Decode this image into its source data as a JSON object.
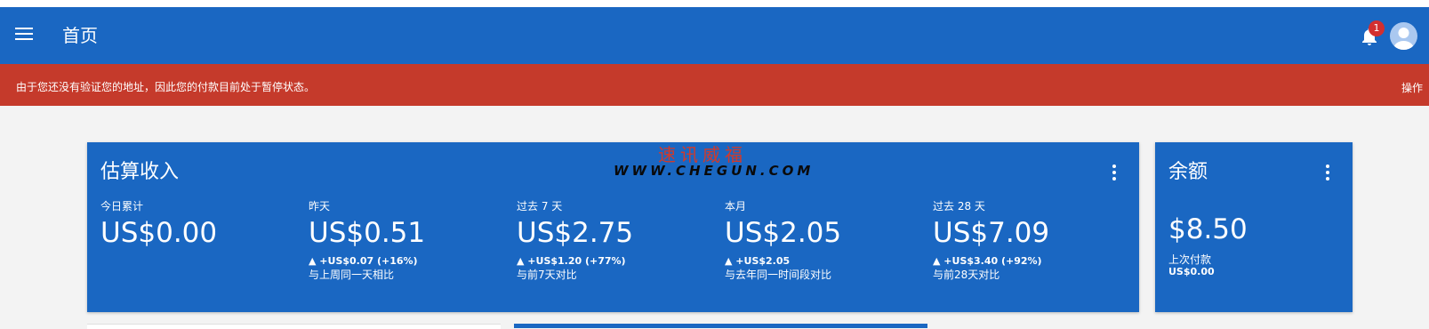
{
  "header": {
    "title": "首页",
    "notification_count": "1"
  },
  "alert": {
    "message": "由于您还没有验证您的地址，因此您的付款目前处于暂停状态。",
    "action": "操作"
  },
  "income_card": {
    "title": "估算收入",
    "stats": [
      {
        "label": "今日累计",
        "value": "US$0.00",
        "delta": "",
        "compare": ""
      },
      {
        "label": "昨天",
        "value": "US$0.51",
        "delta": "▲ +US$0.07 (+16%)",
        "compare": "与上周同一天相比"
      },
      {
        "label": "过去 7 天",
        "value": "US$2.75",
        "delta": "▲ +US$1.20 (+77%)",
        "compare": "与前7天对比"
      },
      {
        "label": "本月",
        "value": "US$2.05",
        "delta": "▲ +US$2.05",
        "compare": "与去年同一时间段对比"
      },
      {
        "label": "过去 28 天",
        "value": "US$7.09",
        "delta": "▲ +US$3.40 (+92%)",
        "compare": "与前28天对比"
      }
    ]
  },
  "watermark": {
    "chinese": "速讯威福",
    "url": "WWW.CHEGUN.COM"
  },
  "balance_card": {
    "title": "余额",
    "value": "$8.50",
    "last_payment_label": "上次付款",
    "last_payment_amount": "US$0.00"
  },
  "colors": {
    "primary": "#1a67c2",
    "alert": "#c53a2b",
    "background": "#f3f3f3"
  }
}
